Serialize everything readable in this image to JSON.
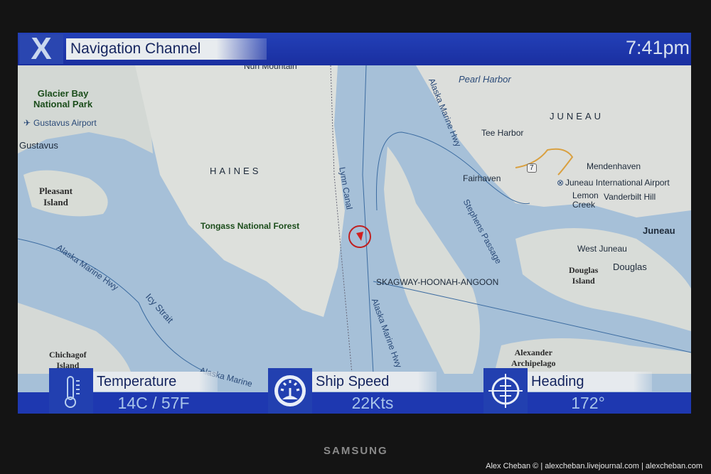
{
  "header": {
    "logo": "X",
    "title": "Navigation Channel",
    "time": "7:41pm"
  },
  "map": {
    "labels": {
      "nun_mountain": "Nun Mountain",
      "glacier_bay": "Glacier Bay\nNational Park",
      "gustavus_airport": "Gustavus Airport",
      "gustavus": "Gustavus",
      "pleasant_island": "Pleasant\nIsland",
      "haines": "HAINES",
      "tongass": "Tongass National Forest",
      "lynn_canal": "Lynn Canal",
      "pearl_harbor": "Pearl Harbor",
      "alaska_marine_hwy_1": "Alaska Marine Hwy",
      "alaska_marine_hwy_2": "Alaska Marine Hwy",
      "alaska_marine_hwy_3": "Alaska Marine Hwy",
      "alaska_marine_4": "Alaska Marine",
      "juneau_region": "JUNEAU",
      "tee_harbor": "Tee Harbor",
      "fairhaven": "Fairhaven",
      "route_7": "7",
      "mendenhaven": "Mendenhaven",
      "juneau_airport": "Juneau International Airport",
      "lemon_creek": "Lemon\nCreek",
      "vanderbilt_hill": "Vanderbilt Hill",
      "juneau": "Juneau",
      "west_juneau": "West Juneau",
      "douglas_island": "Douglas\nIsland",
      "douglas": "Douglas",
      "stephens_passage": "Stephens Passage",
      "skagway": "SKAGWAY-HOONAH-ANGOON",
      "icy_strait": "Icy Strait",
      "chichagof": "Chichagof\nIsland",
      "alexander": "Alexander\nArchipelago"
    },
    "ship_heading_deg": 172
  },
  "status": {
    "temperature": {
      "label": "Temperature",
      "value": "14C / 57F",
      "icon": "thermometer-icon"
    },
    "speed": {
      "label": "Ship Speed",
      "value": "22Kts",
      "icon": "speedometer-icon"
    },
    "heading": {
      "label": "Heading",
      "value": "172°",
      "icon": "crosshair-icon"
    }
  },
  "tv_brand": "SAMSUNG",
  "credit": "Alex Cheban © | alexcheban.livejournal.com | alexcheban.com",
  "colors": {
    "bar": "#1e38b0",
    "water": "#a6c0d8",
    "land": "#d8dcda",
    "ship": "#d02020"
  }
}
